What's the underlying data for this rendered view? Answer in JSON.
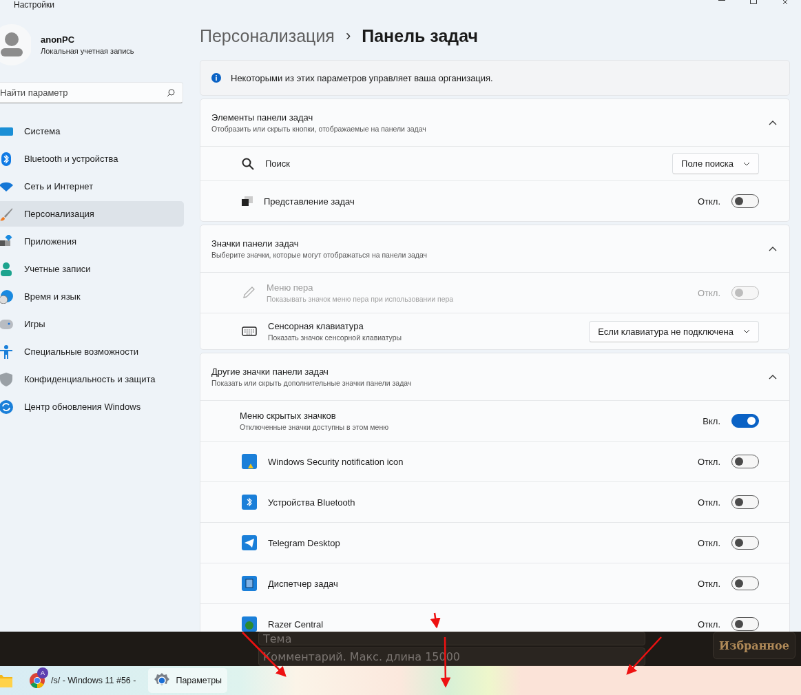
{
  "window": {
    "title": "Настройки"
  },
  "user": {
    "name": "anonPC",
    "account": "Локальная учетная запись"
  },
  "search": {
    "placeholder": "Найти параметр"
  },
  "nav": [
    {
      "label": "Система",
      "selected": false
    },
    {
      "label": "Bluetooth и устройства",
      "selected": false
    },
    {
      "label": "Сеть и Интернет",
      "selected": false
    },
    {
      "label": "Персонализация",
      "selected": true
    },
    {
      "label": "Приложения",
      "selected": false
    },
    {
      "label": "Учетные записи",
      "selected": false
    },
    {
      "label": "Время и язык",
      "selected": false
    },
    {
      "label": "Игры",
      "selected": false
    },
    {
      "label": "Специальные возможности",
      "selected": false
    },
    {
      "label": "Конфиденциальность и защита",
      "selected": false
    },
    {
      "label": "Центр обновления Windows",
      "selected": false
    }
  ],
  "breadcrumb": {
    "parent": "Персонализация",
    "separator": "›",
    "current": "Панель задач"
  },
  "notice": "Некоторыми из этих параметров управляет ваша организация.",
  "sections": [
    {
      "title": "Элементы панели задач",
      "subtitle": "Отобразить или скрыть кнопки, отображаемые на панели задач",
      "expanded": true,
      "rows": [
        {
          "kind": "dropdown",
          "label": "Поиск",
          "value": "Поле поиска"
        },
        {
          "kind": "toggle",
          "label": "Представление задач",
          "state_label": "Откл.",
          "on": false
        }
      ]
    },
    {
      "title": "Значки панели задач",
      "subtitle": "Выберите значки, которые могут отображаться на панели задач",
      "expanded": true,
      "rows": [
        {
          "kind": "toggle",
          "label": "Меню пера",
          "subtitle": "Показывать значок меню пера при использовании пера",
          "state_label": "Откл.",
          "on": false,
          "disabled": true
        },
        {
          "kind": "dropdown",
          "label": "Сенсорная клавиатура",
          "subtitle": "Показать значок сенсорной клавиатуры",
          "value": "Если клавиатура не подключена"
        }
      ]
    },
    {
      "title": "Другие значки панели задач",
      "subtitle": "Показать или скрыть дополнительные значки панели задач",
      "expanded": true,
      "rows": [
        {
          "kind": "toggle",
          "label": "Меню скрытых значков",
          "subtitle": "Отключенные значки доступны в этом меню",
          "state_label": "Вкл.",
          "on": true
        },
        {
          "kind": "toggle",
          "label": "Windows Security notification icon",
          "state_label": "Откл.",
          "on": false
        },
        {
          "kind": "toggle",
          "label": "Устройства Bluetooth",
          "state_label": "Откл.",
          "on": false
        },
        {
          "kind": "toggle",
          "label": "Telegram Desktop",
          "state_label": "Откл.",
          "on": false
        },
        {
          "kind": "toggle",
          "label": "Диспетчер задач",
          "state_label": "Откл.",
          "on": false
        },
        {
          "kind": "toggle",
          "label": "Razer Central",
          "state_label": "Откл.",
          "on": false
        }
      ]
    }
  ],
  "overlay": {
    "fields": [
      {
        "placeholder": "Тема"
      },
      {
        "placeholder": "Комментарий. Макс. длина 15000"
      }
    ],
    "button": "Избранное"
  },
  "taskbar": {
    "items": [
      {
        "kind": "icon",
        "selected": false
      },
      {
        "kind": "app",
        "label": "/s/ - Windows 11 #56 -",
        "badge": "A",
        "selected": false
      },
      {
        "kind": "app",
        "label": "Параметры",
        "selected": true
      }
    ]
  }
}
